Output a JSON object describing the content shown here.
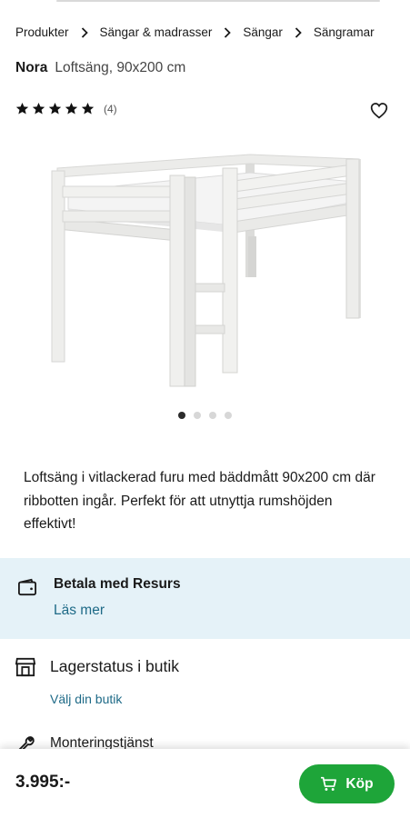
{
  "breadcrumb": [
    {
      "label": "Produkter"
    },
    {
      "label": "Sängar & madrasser"
    },
    {
      "label": "Sängar"
    },
    {
      "label": "Sängramar"
    }
  ],
  "product": {
    "brand": "Nora",
    "subtitle": "Loftsäng, 90x200 cm",
    "rating": 5,
    "rating_count": "(4)",
    "description": "Loftsäng i vitlackerad furu med bäddmått 90x200 cm där ribbotten ingår. Perfekt för att utnyttja rumshöjden effektivt!",
    "image_icon": "white-loft-bed-image"
  },
  "carousel": {
    "count": 4,
    "active": 1
  },
  "payment": {
    "title": "Betala med Resurs",
    "link": "Läs mer",
    "icon": "wallet-icon"
  },
  "stock": {
    "title": "Lagerstatus i butik",
    "link": "Välj din butik",
    "icon": "store-icon"
  },
  "assembly": {
    "title": "Monteringstjänst",
    "icon": "wrench-icon"
  },
  "purchase": {
    "price": "3.995:-",
    "button_label": "Köp",
    "button_icon": "cart-icon"
  },
  "colors": {
    "accent_green": "#1ea539",
    "link_blue": "#1e6a87",
    "info_bg": "#e5f2f8",
    "star": "#111111"
  }
}
